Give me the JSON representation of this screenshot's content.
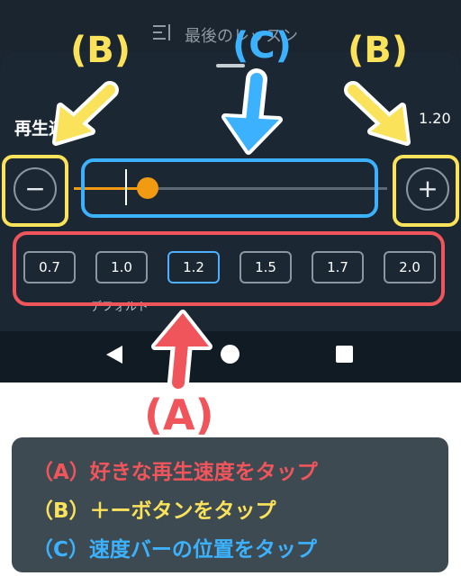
{
  "header": {
    "title": "最後のレッスン"
  },
  "speed_panel": {
    "label": "再生速度",
    "current_value": "1.20",
    "decrease_symbol": "−",
    "increase_symbol": "+",
    "slider_fraction": 0.2,
    "presets": [
      {
        "label": "0.7",
        "selected": false
      },
      {
        "label": "1.0",
        "selected": false
      },
      {
        "label": "1.2",
        "selected": true
      },
      {
        "label": "1.5",
        "selected": false
      },
      {
        "label": "1.7",
        "selected": false
      },
      {
        "label": "2.0",
        "selected": false
      }
    ],
    "default_label": "デフォルト"
  },
  "navbar": {
    "icons": [
      "back-icon",
      "home-icon",
      "recents-icon"
    ]
  },
  "annotations": {
    "mark_a": "(A)",
    "mark_b": "(B)",
    "mark_c": "(C)",
    "legend": {
      "a": "（A）好きな再生速度をタップ",
      "b": "（B）＋ーボタンをタップ",
      "c": "（C）速度バーの位置をタップ"
    }
  },
  "colors": {
    "annotation_a": "#f0555b",
    "annotation_b": "#fbe25b",
    "annotation_c": "#3cb2ff",
    "accent": "#f29a12",
    "selected_preset": "#4fb0ff"
  }
}
